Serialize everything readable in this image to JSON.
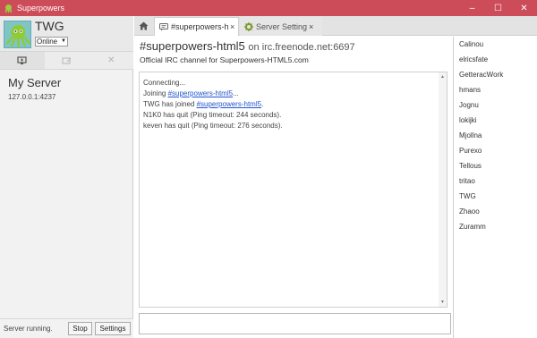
{
  "window": {
    "title": "Superpowers",
    "minimize": "–",
    "maximize": "☐",
    "close": "✕"
  },
  "profile": {
    "name": "TWG",
    "status": "Online"
  },
  "sidebar": {
    "server_name": "My Server",
    "server_address": "127.0.0.1:4237",
    "footer_status": "Server running.",
    "stop_label": "Stop",
    "settings_label": "Settings"
  },
  "tabs": [
    {
      "label": "#superpowers-ht",
      "close": "×"
    },
    {
      "label": "Server Settings",
      "close": "×"
    }
  ],
  "channel": {
    "name": "#superpowers-html5",
    "host": "on irc.freenode.net:6697",
    "topic": "Official IRC channel for Superpowers-HTML5.com"
  },
  "log": {
    "line1": "Connecting...",
    "line2_prefix": "Joining ",
    "line2_link": "#superpowers-html5",
    "line2_suffix": "...",
    "line3_prefix": "TWG has joined ",
    "line3_link": "#superpowers-html5",
    "line3_suffix": ".",
    "line4": "N1K0 has quit (Ping timeout: 244 seconds).",
    "line5": "keven has quit (Ping timeout: 276 seconds)."
  },
  "users": [
    "Calinou",
    "elricsfate",
    "GetteracWork",
    "hmans",
    "Jognu",
    "lokijki",
    "Mjollna",
    "Purexo",
    "Tellous",
    "tritao",
    "TWG",
    "Zhaoo",
    "Zuramm"
  ],
  "colors": {
    "titlebar": "#cc4c5a",
    "link": "#2255cc",
    "accent_green": "#7a9a30"
  }
}
